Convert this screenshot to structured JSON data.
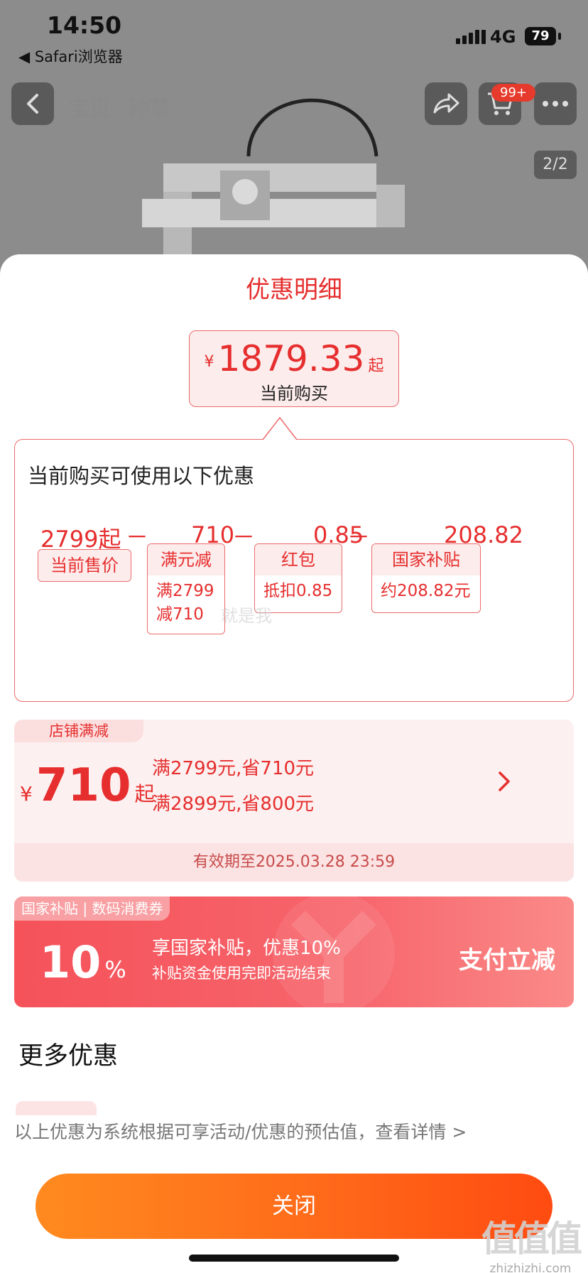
{
  "status_bar": {
    "time": "14:50",
    "back_app": "◀ Safari浏览器",
    "network": "4G",
    "battery": "79"
  },
  "nav": {
    "tabs": [
      "宝贝",
      "种草"
    ],
    "cart_badge": "99+",
    "image_counter": "2/2"
  },
  "sheet": {
    "title": "优惠明细",
    "price": {
      "currency": "¥",
      "value": "1879.33",
      "suffix": "起",
      "caption": "当前购买"
    },
    "detail": {
      "heading": "当前购买可使用以下优惠",
      "operator": "－",
      "items": [
        {
          "value": "2799起",
          "label": "当前售价",
          "desc": []
        },
        {
          "value": "710",
          "label": "满元减",
          "desc": [
            "满2799",
            "减710"
          ]
        },
        {
          "value": "0.85",
          "label": "红包",
          "desc": [
            "抵扣0.85"
          ]
        },
        {
          "value": "208.82",
          "label": "国家补贴",
          "desc": [
            "约208.82元"
          ]
        }
      ],
      "overlay_text": "就是我"
    },
    "store_offer": {
      "tag": "店铺满减",
      "currency": "¥",
      "amount": "710",
      "suffix": "起",
      "rules": [
        "满2799元,省710元",
        "满2899元,省800元"
      ],
      "validity": "有效期至2025.03.28 23:59"
    },
    "subsidy": {
      "tag": "国家补贴 | 数码消费券",
      "percent": "10",
      "percent_sign": "%",
      "main": "享国家补贴，优惠10%",
      "sub": "补贴资金使用完即活动结束",
      "action": "支付立减"
    },
    "more_title": "更多优惠",
    "footnote": "以上优惠为系统根据可享活动/优惠的预估值，查看详情 >",
    "close_label": "关闭"
  },
  "watermark": {
    "main": "值值值",
    "sub": "zhizhizhi.com"
  },
  "colors": {
    "accent_red": "#e62e2e",
    "close_gradient_start": "#ff8a1f",
    "close_gradient_end": "#ff4b11"
  }
}
